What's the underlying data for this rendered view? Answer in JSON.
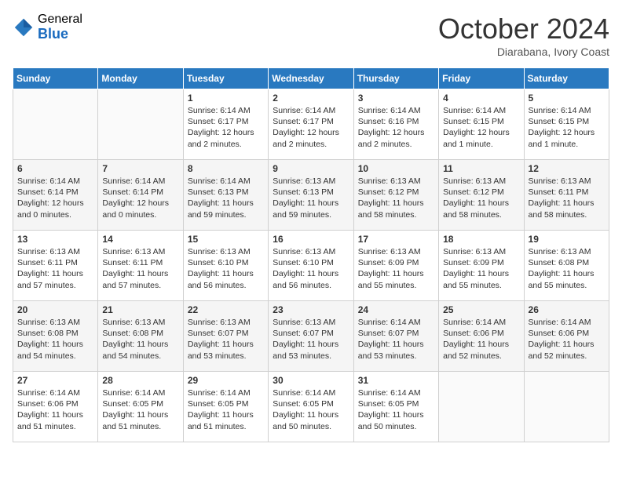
{
  "header": {
    "logo_general": "General",
    "logo_blue": "Blue",
    "month_title": "October 2024",
    "location": "Diarabana, Ivory Coast"
  },
  "weekdays": [
    "Sunday",
    "Monday",
    "Tuesday",
    "Wednesday",
    "Thursday",
    "Friday",
    "Saturday"
  ],
  "weeks": [
    [
      {
        "day": "",
        "sunrise": "",
        "sunset": "",
        "daylight": ""
      },
      {
        "day": "",
        "sunrise": "",
        "sunset": "",
        "daylight": ""
      },
      {
        "day": "1",
        "sunrise": "Sunrise: 6:14 AM",
        "sunset": "Sunset: 6:17 PM",
        "daylight": "Daylight: 12 hours and 2 minutes."
      },
      {
        "day": "2",
        "sunrise": "Sunrise: 6:14 AM",
        "sunset": "Sunset: 6:17 PM",
        "daylight": "Daylight: 12 hours and 2 minutes."
      },
      {
        "day": "3",
        "sunrise": "Sunrise: 6:14 AM",
        "sunset": "Sunset: 6:16 PM",
        "daylight": "Daylight: 12 hours and 2 minutes."
      },
      {
        "day": "4",
        "sunrise": "Sunrise: 6:14 AM",
        "sunset": "Sunset: 6:15 PM",
        "daylight": "Daylight: 12 hours and 1 minute."
      },
      {
        "day": "5",
        "sunrise": "Sunrise: 6:14 AM",
        "sunset": "Sunset: 6:15 PM",
        "daylight": "Daylight: 12 hours and 1 minute."
      }
    ],
    [
      {
        "day": "6",
        "sunrise": "Sunrise: 6:14 AM",
        "sunset": "Sunset: 6:14 PM",
        "daylight": "Daylight: 12 hours and 0 minutes."
      },
      {
        "day": "7",
        "sunrise": "Sunrise: 6:14 AM",
        "sunset": "Sunset: 6:14 PM",
        "daylight": "Daylight: 12 hours and 0 minutes."
      },
      {
        "day": "8",
        "sunrise": "Sunrise: 6:14 AM",
        "sunset": "Sunset: 6:13 PM",
        "daylight": "Daylight: 11 hours and 59 minutes."
      },
      {
        "day": "9",
        "sunrise": "Sunrise: 6:13 AM",
        "sunset": "Sunset: 6:13 PM",
        "daylight": "Daylight: 11 hours and 59 minutes."
      },
      {
        "day": "10",
        "sunrise": "Sunrise: 6:13 AM",
        "sunset": "Sunset: 6:12 PM",
        "daylight": "Daylight: 11 hours and 58 minutes."
      },
      {
        "day": "11",
        "sunrise": "Sunrise: 6:13 AM",
        "sunset": "Sunset: 6:12 PM",
        "daylight": "Daylight: 11 hours and 58 minutes."
      },
      {
        "day": "12",
        "sunrise": "Sunrise: 6:13 AM",
        "sunset": "Sunset: 6:11 PM",
        "daylight": "Daylight: 11 hours and 58 minutes."
      }
    ],
    [
      {
        "day": "13",
        "sunrise": "Sunrise: 6:13 AM",
        "sunset": "Sunset: 6:11 PM",
        "daylight": "Daylight: 11 hours and 57 minutes."
      },
      {
        "day": "14",
        "sunrise": "Sunrise: 6:13 AM",
        "sunset": "Sunset: 6:11 PM",
        "daylight": "Daylight: 11 hours and 57 minutes."
      },
      {
        "day": "15",
        "sunrise": "Sunrise: 6:13 AM",
        "sunset": "Sunset: 6:10 PM",
        "daylight": "Daylight: 11 hours and 56 minutes."
      },
      {
        "day": "16",
        "sunrise": "Sunrise: 6:13 AM",
        "sunset": "Sunset: 6:10 PM",
        "daylight": "Daylight: 11 hours and 56 minutes."
      },
      {
        "day": "17",
        "sunrise": "Sunrise: 6:13 AM",
        "sunset": "Sunset: 6:09 PM",
        "daylight": "Daylight: 11 hours and 55 minutes."
      },
      {
        "day": "18",
        "sunrise": "Sunrise: 6:13 AM",
        "sunset": "Sunset: 6:09 PM",
        "daylight": "Daylight: 11 hours and 55 minutes."
      },
      {
        "day": "19",
        "sunrise": "Sunrise: 6:13 AM",
        "sunset": "Sunset: 6:08 PM",
        "daylight": "Daylight: 11 hours and 55 minutes."
      }
    ],
    [
      {
        "day": "20",
        "sunrise": "Sunrise: 6:13 AM",
        "sunset": "Sunset: 6:08 PM",
        "daylight": "Daylight: 11 hours and 54 minutes."
      },
      {
        "day": "21",
        "sunrise": "Sunrise: 6:13 AM",
        "sunset": "Sunset: 6:08 PM",
        "daylight": "Daylight: 11 hours and 54 minutes."
      },
      {
        "day": "22",
        "sunrise": "Sunrise: 6:13 AM",
        "sunset": "Sunset: 6:07 PM",
        "daylight": "Daylight: 11 hours and 53 minutes."
      },
      {
        "day": "23",
        "sunrise": "Sunrise: 6:13 AM",
        "sunset": "Sunset: 6:07 PM",
        "daylight": "Daylight: 11 hours and 53 minutes."
      },
      {
        "day": "24",
        "sunrise": "Sunrise: 6:14 AM",
        "sunset": "Sunset: 6:07 PM",
        "daylight": "Daylight: 11 hours and 53 minutes."
      },
      {
        "day": "25",
        "sunrise": "Sunrise: 6:14 AM",
        "sunset": "Sunset: 6:06 PM",
        "daylight": "Daylight: 11 hours and 52 minutes."
      },
      {
        "day": "26",
        "sunrise": "Sunrise: 6:14 AM",
        "sunset": "Sunset: 6:06 PM",
        "daylight": "Daylight: 11 hours and 52 minutes."
      }
    ],
    [
      {
        "day": "27",
        "sunrise": "Sunrise: 6:14 AM",
        "sunset": "Sunset: 6:06 PM",
        "daylight": "Daylight: 11 hours and 51 minutes."
      },
      {
        "day": "28",
        "sunrise": "Sunrise: 6:14 AM",
        "sunset": "Sunset: 6:05 PM",
        "daylight": "Daylight: 11 hours and 51 minutes."
      },
      {
        "day": "29",
        "sunrise": "Sunrise: 6:14 AM",
        "sunset": "Sunset: 6:05 PM",
        "daylight": "Daylight: 11 hours and 51 minutes."
      },
      {
        "day": "30",
        "sunrise": "Sunrise: 6:14 AM",
        "sunset": "Sunset: 6:05 PM",
        "daylight": "Daylight: 11 hours and 50 minutes."
      },
      {
        "day": "31",
        "sunrise": "Sunrise: 6:14 AM",
        "sunset": "Sunset: 6:05 PM",
        "daylight": "Daylight: 11 hours and 50 minutes."
      },
      {
        "day": "",
        "sunrise": "",
        "sunset": "",
        "daylight": ""
      },
      {
        "day": "",
        "sunrise": "",
        "sunset": "",
        "daylight": ""
      }
    ]
  ]
}
